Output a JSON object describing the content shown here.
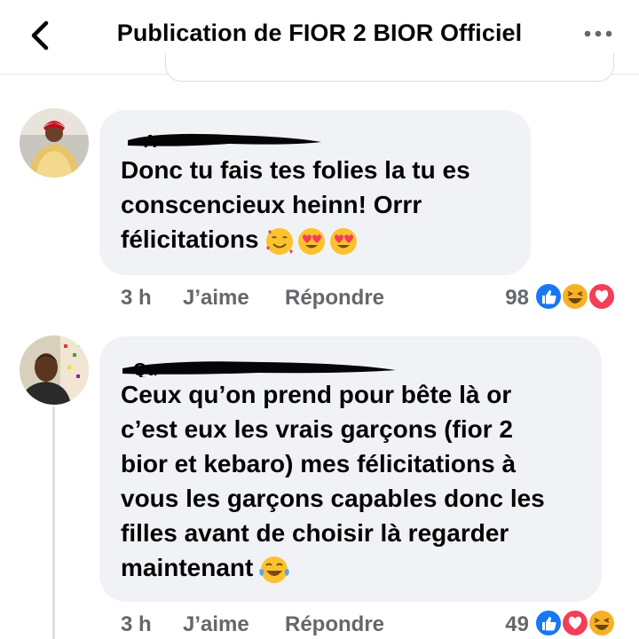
{
  "header": {
    "title": "Publication de FIOR 2 BIOR Officiel",
    "back_icon": "chevron-left-icon",
    "more_icon": "more-horizontal-icon"
  },
  "comments": [
    {
      "text_lines": [
        "Donc tu fais tes folies  la tu es",
        "conscencieux heinn! Orrr",
        "félicitations"
      ],
      "emojis": [
        "smiling-face-with-hearts",
        "heart-eyes",
        "heart-eyes"
      ],
      "time": "3 h",
      "like_label": "J’aime",
      "reply_label": "Répondre",
      "reaction_count": "98",
      "reactions": [
        "like",
        "haha",
        "love"
      ]
    },
    {
      "text_lines": [
        "Ceux qu’on prend pour bête là or",
        "c’est eux les vrais garçons (fior 2",
        "bior et kebaro) mes félicitations à",
        "vous les garçons capables donc les",
        "filles avant de choisir là regarder",
        "maintenant"
      ],
      "emojis": [
        "tears-of-joy"
      ],
      "time": "3 h",
      "like_label": "J’aime",
      "reply_label": "Répondre",
      "reaction_count": "49",
      "reactions": [
        "like",
        "love",
        "haha"
      ]
    }
  ],
  "colors": {
    "like": "#1877f2",
    "love": "#f33e58",
    "haha": "#f7b125",
    "bubble": "#f0f2f5",
    "meta": "#65676b"
  }
}
